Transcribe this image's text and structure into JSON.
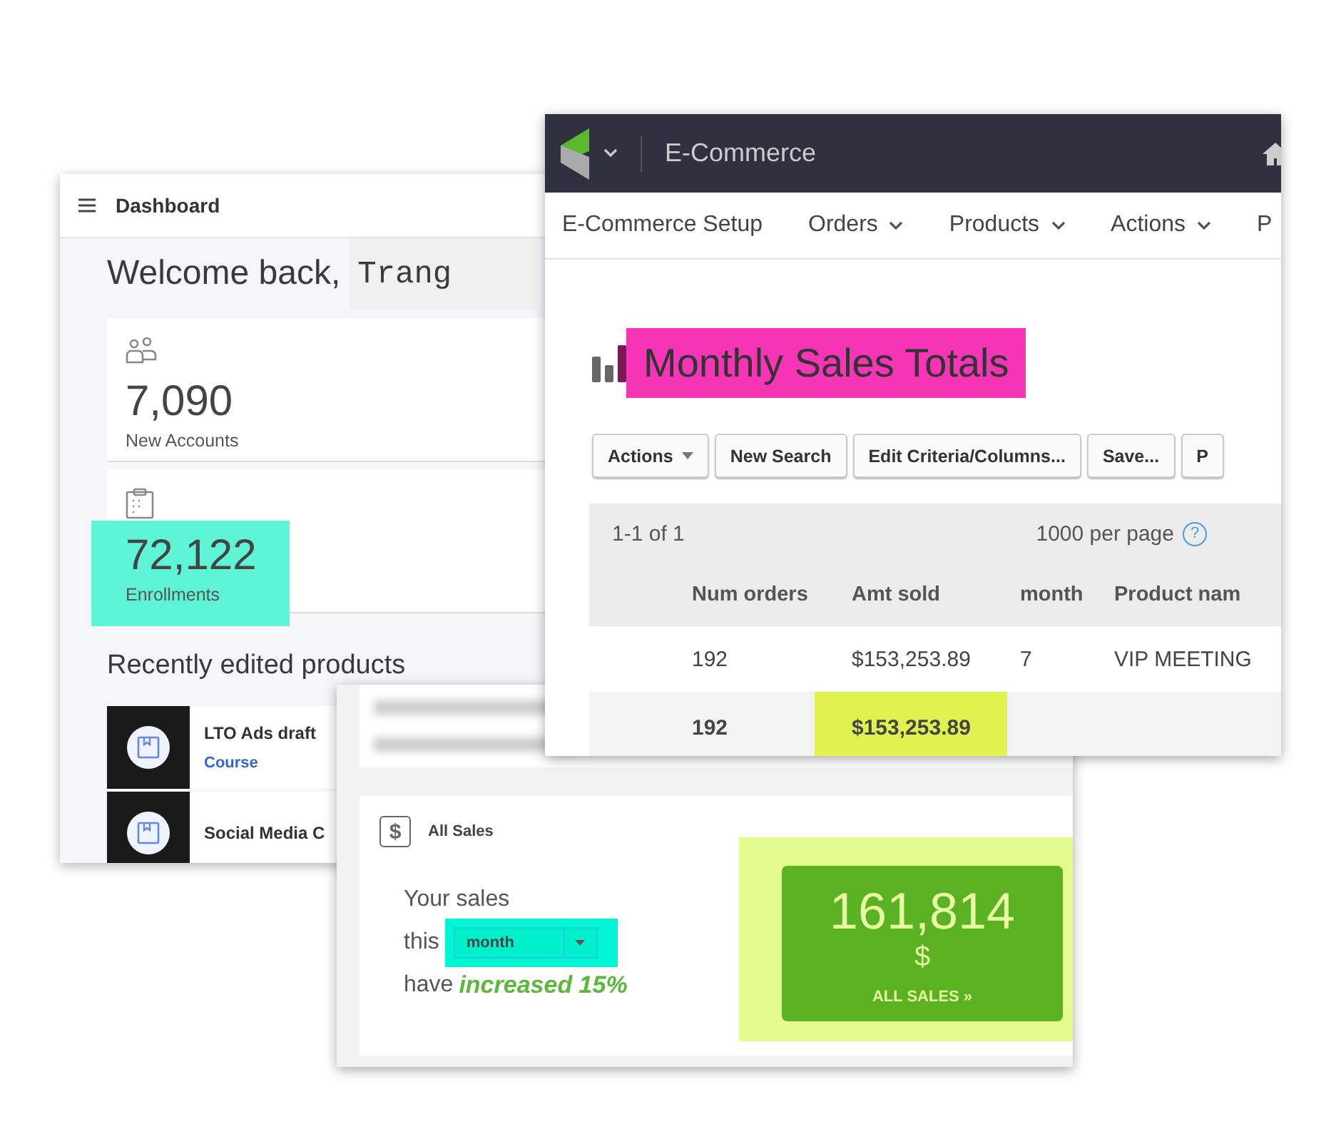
{
  "dashboard": {
    "title": "Dashboard",
    "greeting": "Welcome back,",
    "user_name": "Trang",
    "stats": [
      {
        "kind": "accounts",
        "value": "7,090",
        "label": "New Accounts",
        "highlighted": false
      },
      {
        "kind": "enrollments",
        "value": "72,122",
        "label": "Enrollments",
        "highlighted": true
      }
    ],
    "section_title": "Recently edited products",
    "products": [
      {
        "name": "LTO Ads draft",
        "type": "Course"
      },
      {
        "name": "Social Media C"
      }
    ]
  },
  "ecommerce": {
    "app_title": "E-Commerce",
    "nav": [
      {
        "label": "E-Commerce Setup",
        "dropdown": false
      },
      {
        "label": "Orders",
        "dropdown": true
      },
      {
        "label": "Products",
        "dropdown": true
      },
      {
        "label": "Actions",
        "dropdown": true
      },
      {
        "label": "P",
        "dropdown": false
      }
    ],
    "report_title": "Monthly Sales Totals",
    "toolbar": [
      {
        "label": "Actions",
        "dropdown": true
      },
      {
        "label": "New Search",
        "dropdown": false
      },
      {
        "label": "Edit Criteria/Columns...",
        "dropdown": false
      },
      {
        "label": "Save...",
        "dropdown": false
      },
      {
        "label": "P",
        "dropdown": false
      }
    ],
    "pagination": "1-1 of 1",
    "per_page": "1000 per page",
    "help_mark": "?",
    "table": {
      "columns": [
        "Num orders",
        "Amt sold",
        "month",
        "Product nam"
      ],
      "rows": [
        [
          "192",
          "$153,253.89",
          "7",
          "VIP MEETING"
        ]
      ],
      "total": [
        "192",
        "$153,253.89"
      ]
    }
  },
  "sales": {
    "icon_mark": "$",
    "title": "All Sales",
    "line_1": "Your sales",
    "line_2": "this",
    "period": "month",
    "line_3": "have",
    "change": "increased 15%",
    "total": "161,814",
    "currency": "$",
    "link": "ALL SALES »"
  }
}
